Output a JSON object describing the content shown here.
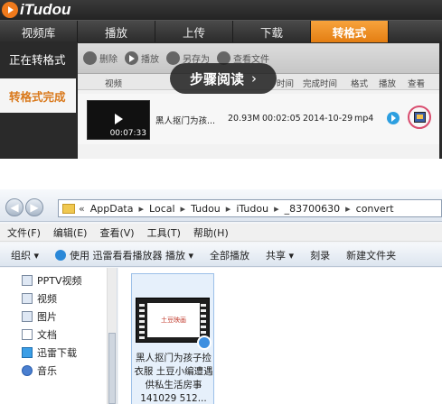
{
  "app": {
    "logo_text": "iTudou",
    "nav": [
      {
        "label": "视频库"
      },
      {
        "label": "播放"
      },
      {
        "label": "上传"
      },
      {
        "label": "下载"
      },
      {
        "label": "转格式"
      }
    ],
    "sidebar": [
      {
        "label": "正在转格式"
      },
      {
        "label": "转格式完成"
      }
    ],
    "toolbar": {
      "delete": "删除",
      "play": "播放",
      "save_as": "另存为",
      "view_file": "查看文件"
    },
    "columns": {
      "video": "视频",
      "time": "时间",
      "completed": "完成时间",
      "format": "格式",
      "play": "播放",
      "view": "查看"
    },
    "row": {
      "duration": "00:07:33",
      "title": "黑人抠门为孩...",
      "size": "20.93M",
      "length": "00:02:05",
      "date": "2014-10-29",
      "format": "mp4"
    },
    "overlay": {
      "label": "步骤阅读",
      "arrow": "›"
    }
  },
  "explorer": {
    "path": [
      "AppData",
      "Local",
      "Tudou",
      "iTudou",
      "_83700630",
      "convert"
    ],
    "path_prefix": "«",
    "menu": [
      "文件(F)",
      "编辑(E)",
      "查看(V)",
      "工具(T)",
      "帮助(H)"
    ],
    "commands": {
      "organize": "组织 ▾",
      "play_with": "使用 迅雷看看播放器 播放 ▾",
      "play_all": "全部播放",
      "share": "共享 ▾",
      "burn": "刻录",
      "new_folder": "新建文件夹"
    },
    "tree": [
      "PPTV视频",
      "视频",
      "图片",
      "文档",
      "迅雷下载",
      "音乐"
    ],
    "file": {
      "thumb_text": "土豆映画",
      "name": "黑人抠门为孩子捡衣服 土豆小编遭遇供私生活房事 141029 512..."
    }
  }
}
